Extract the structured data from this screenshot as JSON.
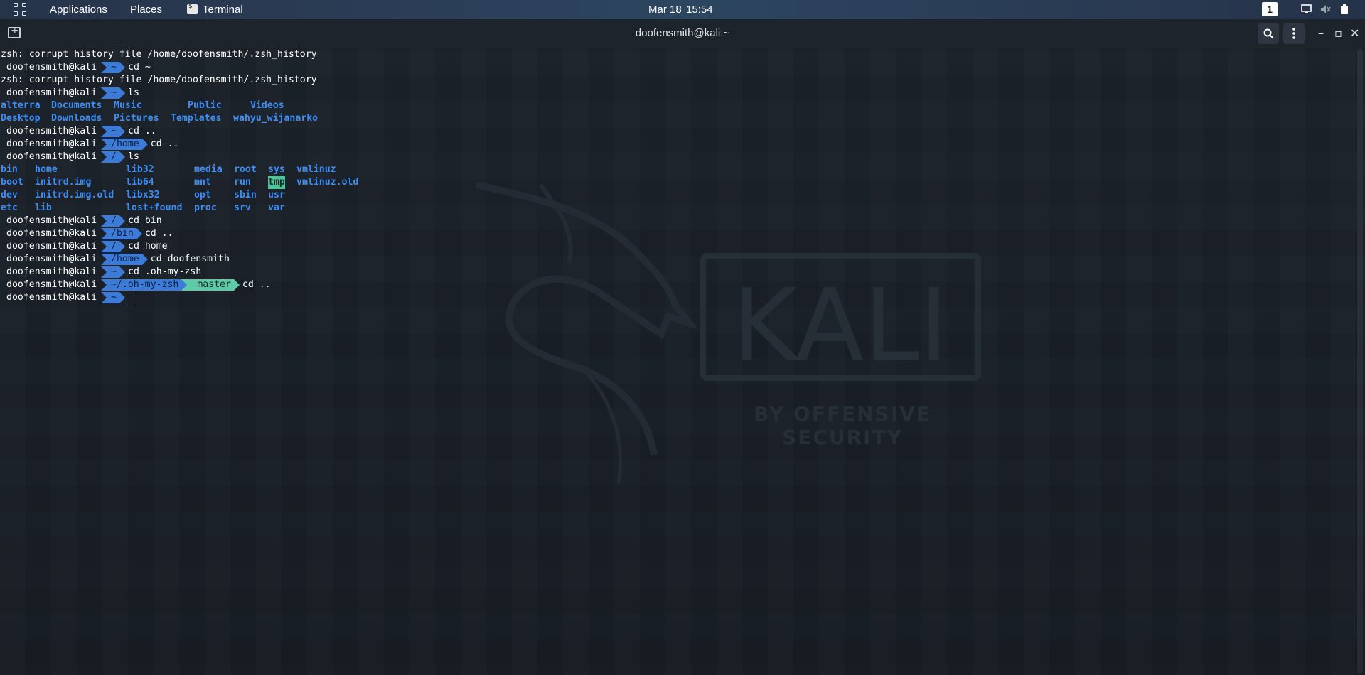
{
  "topbar": {
    "applications": "Applications",
    "places": "Places",
    "terminal": "Terminal",
    "date": "Mar 18",
    "time": "15:54",
    "workspace": "1"
  },
  "window": {
    "title": "doofensmith@kali:~"
  },
  "wallpaper": {
    "brand": "KALI",
    "tagline": "BY OFFENSIVE SECURITY"
  },
  "terminal": {
    "user": "doofensmith@kali",
    "warn1": "zsh: corrupt history file /home/doofensmith/.zsh_history",
    "cmd1": "cd ~",
    "warn2": "zsh: corrupt history file /home/doofensmith/.zsh_history",
    "cmd2": "ls",
    "ls_home_row1": [
      "alterra",
      "Documents",
      "Music",
      "Public",
      "Videos"
    ],
    "ls_home_row2": [
      "Desktop",
      "Downloads",
      "Pictures",
      "Templates",
      "wahyu_wijanarko"
    ],
    "cmd3": "cd ..",
    "dir_home": "/home",
    "cmd4": "cd ..",
    "dir_root": "/",
    "cmd5": "ls",
    "ls_root": [
      [
        "bin",
        "home",
        "lib32",
        "media",
        "root",
        "sys",
        "vmlinuz"
      ],
      [
        "boot",
        "initrd.img",
        "lib64",
        "mnt",
        "run",
        "tmp",
        "vmlinuz.old"
      ],
      [
        "dev",
        "initrd.img.old",
        "libx32",
        "opt",
        "sbin",
        "usr",
        ""
      ],
      [
        "etc",
        "lib",
        "lost+found",
        "proc",
        "srv",
        "var",
        ""
      ]
    ],
    "cmd6": "cd bin",
    "dir_bin": "/bin",
    "cmd7": "cd ..",
    "cmd8": "cd home",
    "cmd9": "cd doofensmith",
    "cmd10": "cd .oh-my-zsh",
    "dir_ohmyzsh": "~/.oh-my-zsh",
    "git_branch": "master",
    "git_icon": "",
    "cmd11": "cd ..",
    "home_tilde": "~"
  }
}
